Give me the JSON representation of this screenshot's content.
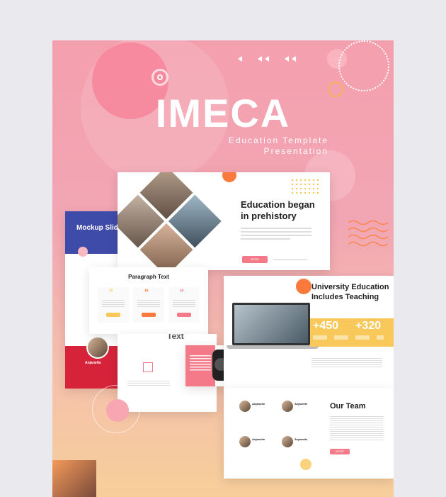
{
  "hero": {
    "title": "IMECA",
    "subtitle_line1": "Education Template",
    "subtitle_line2": "Presentation"
  },
  "slides": {
    "education": {
      "heading_line1": "Education began",
      "heading_line2": "in prehistory",
      "button": "MORE"
    },
    "mockup": {
      "heading": "Mockup Slid"
    },
    "paragraph": {
      "heading": "Paragraph Text",
      "quote_mark": "“"
    },
    "profile": {
      "name": "Anjanette"
    },
    "text_slide": {
      "heading": "Text"
    },
    "university": {
      "heading_line1": "University Education",
      "heading_line2": "Includes Teaching",
      "stat1": "+450",
      "stat2": "+320"
    },
    "team": {
      "heading": "Our Team",
      "member_name": "Anjanette",
      "button": "MORE"
    }
  },
  "colors": {
    "accent_coral": "#f47a8a",
    "accent_orange": "#f97a3c",
    "accent_yellow": "#f8c85a",
    "navy": "#3f4ba8",
    "red": "#d6233a"
  }
}
